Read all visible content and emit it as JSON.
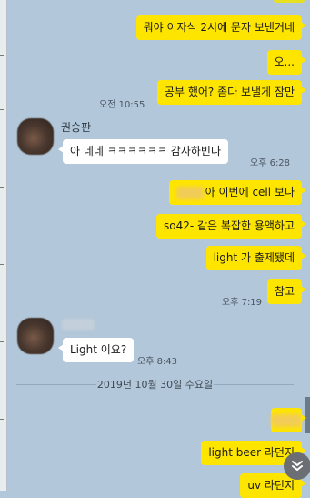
{
  "messages": {
    "m1": "뭐야 이자식 2시에 문자 보낸거네",
    "m2": "오...",
    "m3": "공부 했어? 좀다 보낼게 잠만",
    "m3_time": "오전 10:55",
    "sender1_name": "권승판",
    "m4": "아 네네  ㅋㅋㅋㅋㅋㅋ 감사하빈다",
    "m4_time": "오후 6:28",
    "m5": "아 이번에 cell 보다",
    "m6": "so42- 같은 복잡한 용액하고",
    "m7": "light 가 출제됐데",
    "m8": "참고",
    "m8_time": "오후 7:19",
    "m9": "Light 이요?",
    "m9_time": "오후 8:43",
    "m10": "light beer 라던지",
    "m11": "uv 라던지"
  },
  "date_divider": "2019년 10월 30일 수요일",
  "icons": {
    "scroll_down": "double-chevron-down-icon"
  },
  "colors": {
    "chat_bg": "#b2c7d9",
    "my_bubble": "#fee500",
    "other_bubble": "#ffffff"
  }
}
